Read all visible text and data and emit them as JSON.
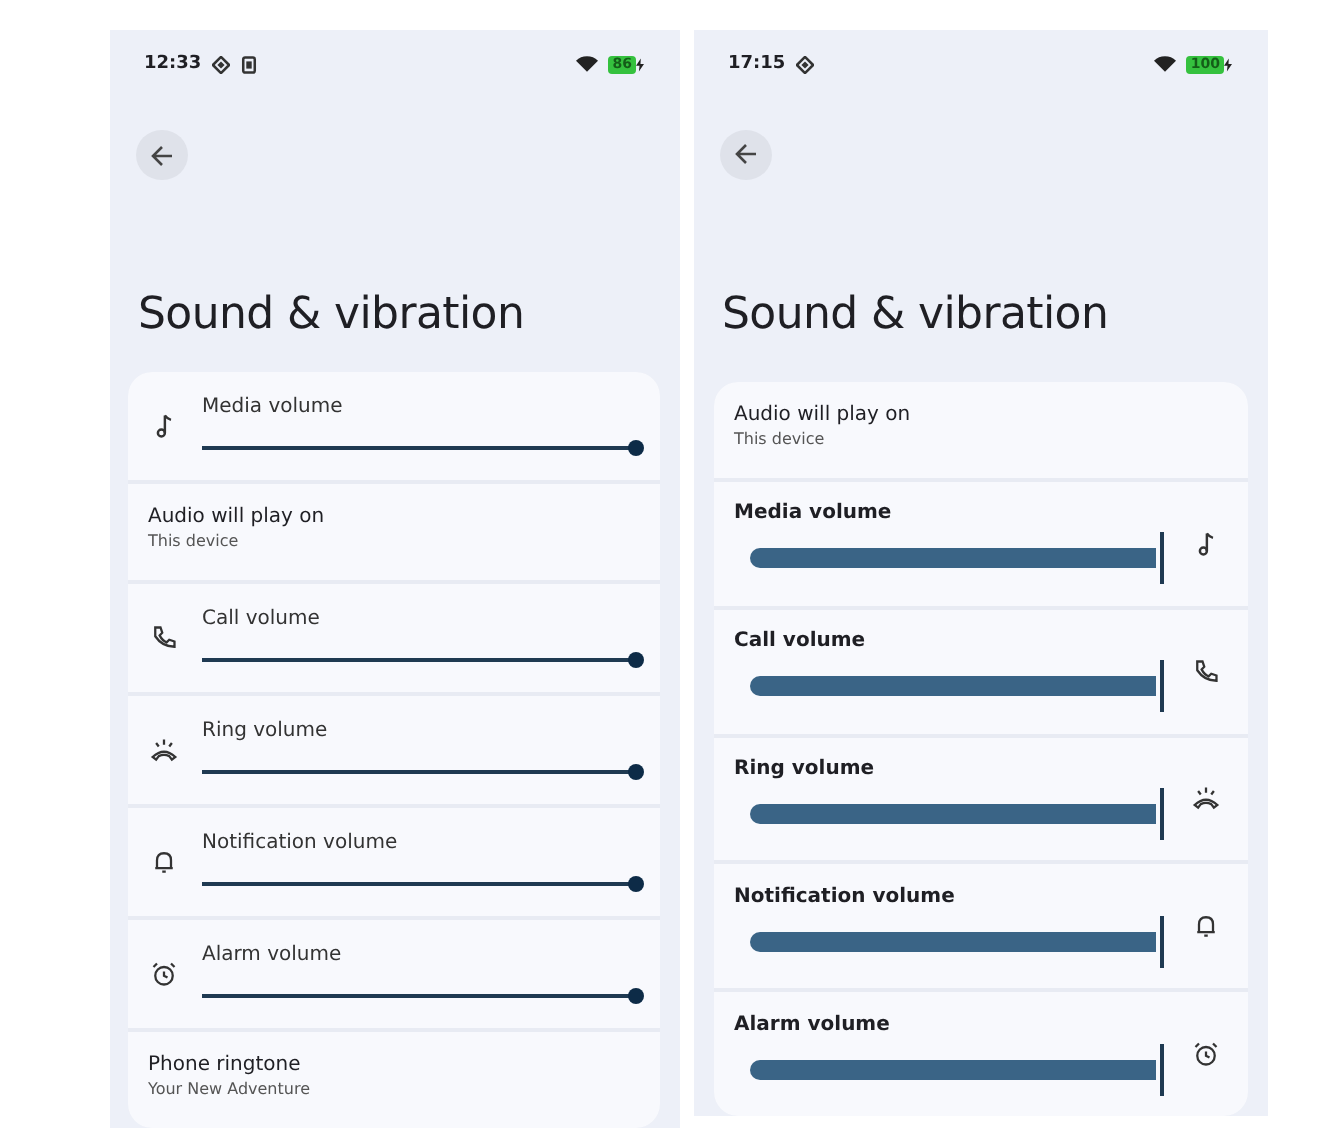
{
  "screens": [
    {
      "status_bar": {
        "time": "12:33",
        "indicators": [
          {
            "kind": "diamond"
          },
          {
            "kind": "phone"
          }
        ],
        "battery": "86",
        "charging": true
      },
      "title": "Sound & vibration",
      "items": [
        {
          "kind": "media",
          "label": "Media volume",
          "level": 1
        },
        {
          "kind": "info",
          "label": "Audio will play on",
          "sub": "This device"
        },
        {
          "kind": "call",
          "label": "Call volume",
          "level": 1
        },
        {
          "kind": "ring",
          "label": "Ring volume",
          "level": 1
        },
        {
          "kind": "notification",
          "label": "Notification volume",
          "level": 1
        },
        {
          "kind": "alarm",
          "label": "Alarm volume",
          "level": 1
        },
        {
          "kind": "info",
          "label": "Phone ringtone",
          "sub": "Your New Adventure"
        }
      ]
    },
    {
      "status_bar": {
        "time": "17:15",
        "indicators": [
          {
            "kind": "diamond"
          }
        ],
        "battery": "100",
        "charging": true
      },
      "title": "Sound & vibration",
      "items": [
        {
          "kind": "info",
          "label": "Audio will play on",
          "sub": "This device"
        },
        {
          "kind": "media",
          "label": "Media volume",
          "level": 1
        },
        {
          "kind": "call",
          "label": "Call volume",
          "level": 1
        },
        {
          "kind": "ring",
          "label": "Ring volume",
          "level": 1
        },
        {
          "kind": "notification",
          "label": "Notification volume",
          "level": 1
        },
        {
          "kind": "alarm",
          "label": "Alarm volume",
          "level": 1
        }
      ]
    }
  ]
}
